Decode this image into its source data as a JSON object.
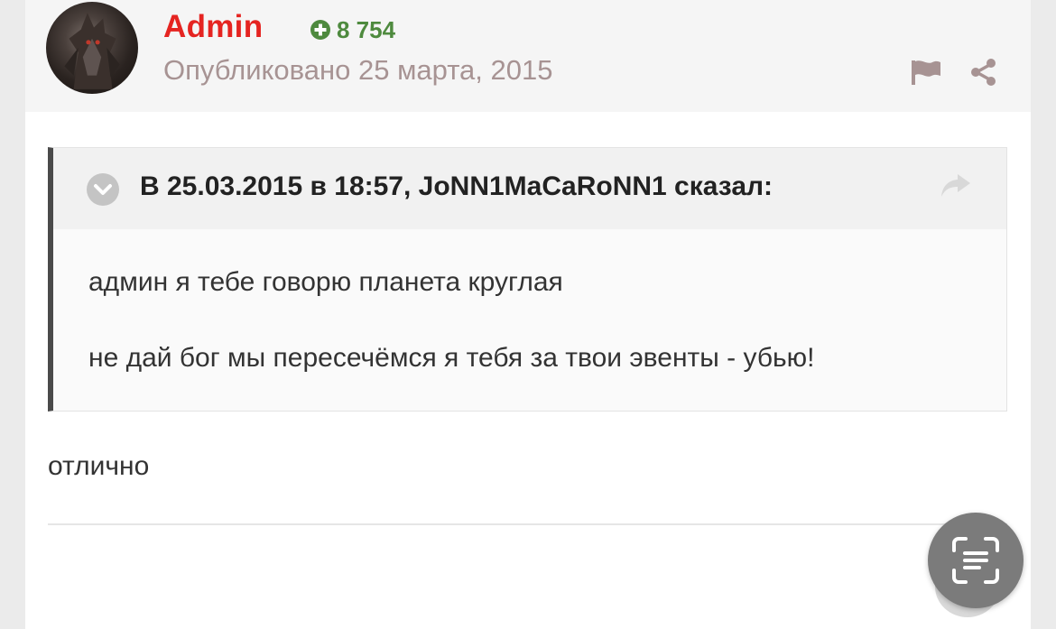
{
  "post": {
    "author": "Admin",
    "reputation": "8 754",
    "posted": "Опубликовано 25 марта, 2015",
    "quote": {
      "citation": "В 25.03.2015 в 18:57, JoNN1MaCaRoNN1 сказал:",
      "lines": [
        "админ я тебе говорю планета круглая",
        "не дай бог мы пересечёмся я тебя за твои эвенты - убью!"
      ]
    },
    "body": "отлично"
  },
  "icons": {
    "reputation": "plus-circle-icon",
    "report": "flag-icon",
    "share": "share-icon",
    "quote_toggle": "chevron-down-circle-icon",
    "quote_goto": "reply-arrow-icon",
    "screen_lens": "text-scan-icon"
  },
  "colors": {
    "author": "#e52421",
    "reputation": "#4e8a3e",
    "date": "#a79393",
    "quote_border": "#4a4a4a"
  }
}
